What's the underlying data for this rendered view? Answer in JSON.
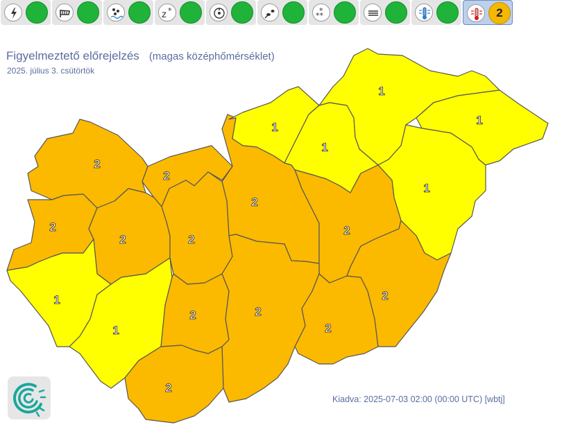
{
  "toolbar": [
    {
      "icon": "lightning-icon",
      "level": ""
    },
    {
      "icon": "wind-icon",
      "level": ""
    },
    {
      "icon": "rain-icon",
      "level": ""
    },
    {
      "icon": "snow-rain-icon",
      "level": ""
    },
    {
      "icon": "freezing-rain-icon",
      "level": ""
    },
    {
      "icon": "snow-drift-icon",
      "level": ""
    },
    {
      "icon": "snow-icon",
      "level": ""
    },
    {
      "icon": "fog-icon",
      "level": ""
    },
    {
      "icon": "cold-icon",
      "level": ""
    },
    {
      "icon": "heat-icon",
      "level": "2",
      "active": true
    }
  ],
  "header": {
    "title": "Figyelmeztető előrejelzés",
    "subtitle": "(magas középhőmérséklet)",
    "date": "2025. július 3. csütörtök"
  },
  "footer": {
    "issued": "Kiadva: 2025-07-03 02:00 (00:00 UTC) [wbtj]"
  },
  "colors": {
    "level1": "#ffff00",
    "level2": "#fbb900",
    "border": "#555555"
  },
  "counties": [
    {
      "id": "gyor",
      "level": "2"
    },
    {
      "id": "komarom",
      "level": "2"
    },
    {
      "id": "pest",
      "level": "2"
    },
    {
      "id": "nograd",
      "level": "1"
    },
    {
      "id": "heves",
      "level": "1"
    },
    {
      "id": "borsod",
      "level": "1"
    },
    {
      "id": "szabolcs",
      "level": "1"
    },
    {
      "id": "hajdu",
      "level": "1"
    },
    {
      "id": "vas",
      "level": "2"
    },
    {
      "id": "veszprem",
      "level": "2"
    },
    {
      "id": "fejer",
      "level": "2"
    },
    {
      "id": "szolnok",
      "level": "2"
    },
    {
      "id": "zala",
      "level": "1"
    },
    {
      "id": "somogy",
      "level": "1"
    },
    {
      "id": "tolna",
      "level": "2"
    },
    {
      "id": "bacs",
      "level": "2"
    },
    {
      "id": "csongrad",
      "level": "2"
    },
    {
      "id": "bekes",
      "level": "2"
    },
    {
      "id": "baranya",
      "level": "2"
    }
  ]
}
